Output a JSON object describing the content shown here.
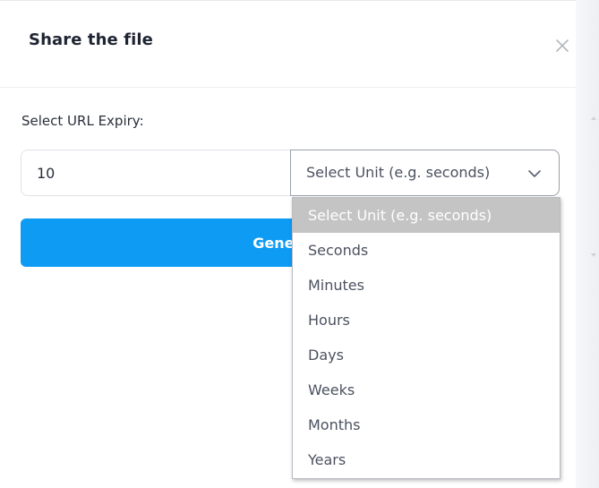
{
  "dialog": {
    "title": "Share the file"
  },
  "form": {
    "expiry_label": "Select URL Expiry:",
    "number_value": "10",
    "unit_select_value": "Select Unit (e.g. seconds)",
    "generate_button_label": "Generate"
  },
  "dropdown": {
    "options": [
      "Select Unit (e.g. seconds)",
      "Seconds",
      "Minutes",
      "Hours",
      "Days",
      "Weeks",
      "Months",
      "Years"
    ],
    "highlighted_index": 0
  },
  "icons": {
    "close": "close-icon",
    "chevron": "chevron-down-icon"
  },
  "colors": {
    "primary": "#0e9bf4",
    "highlight": "#c4c4c4"
  }
}
